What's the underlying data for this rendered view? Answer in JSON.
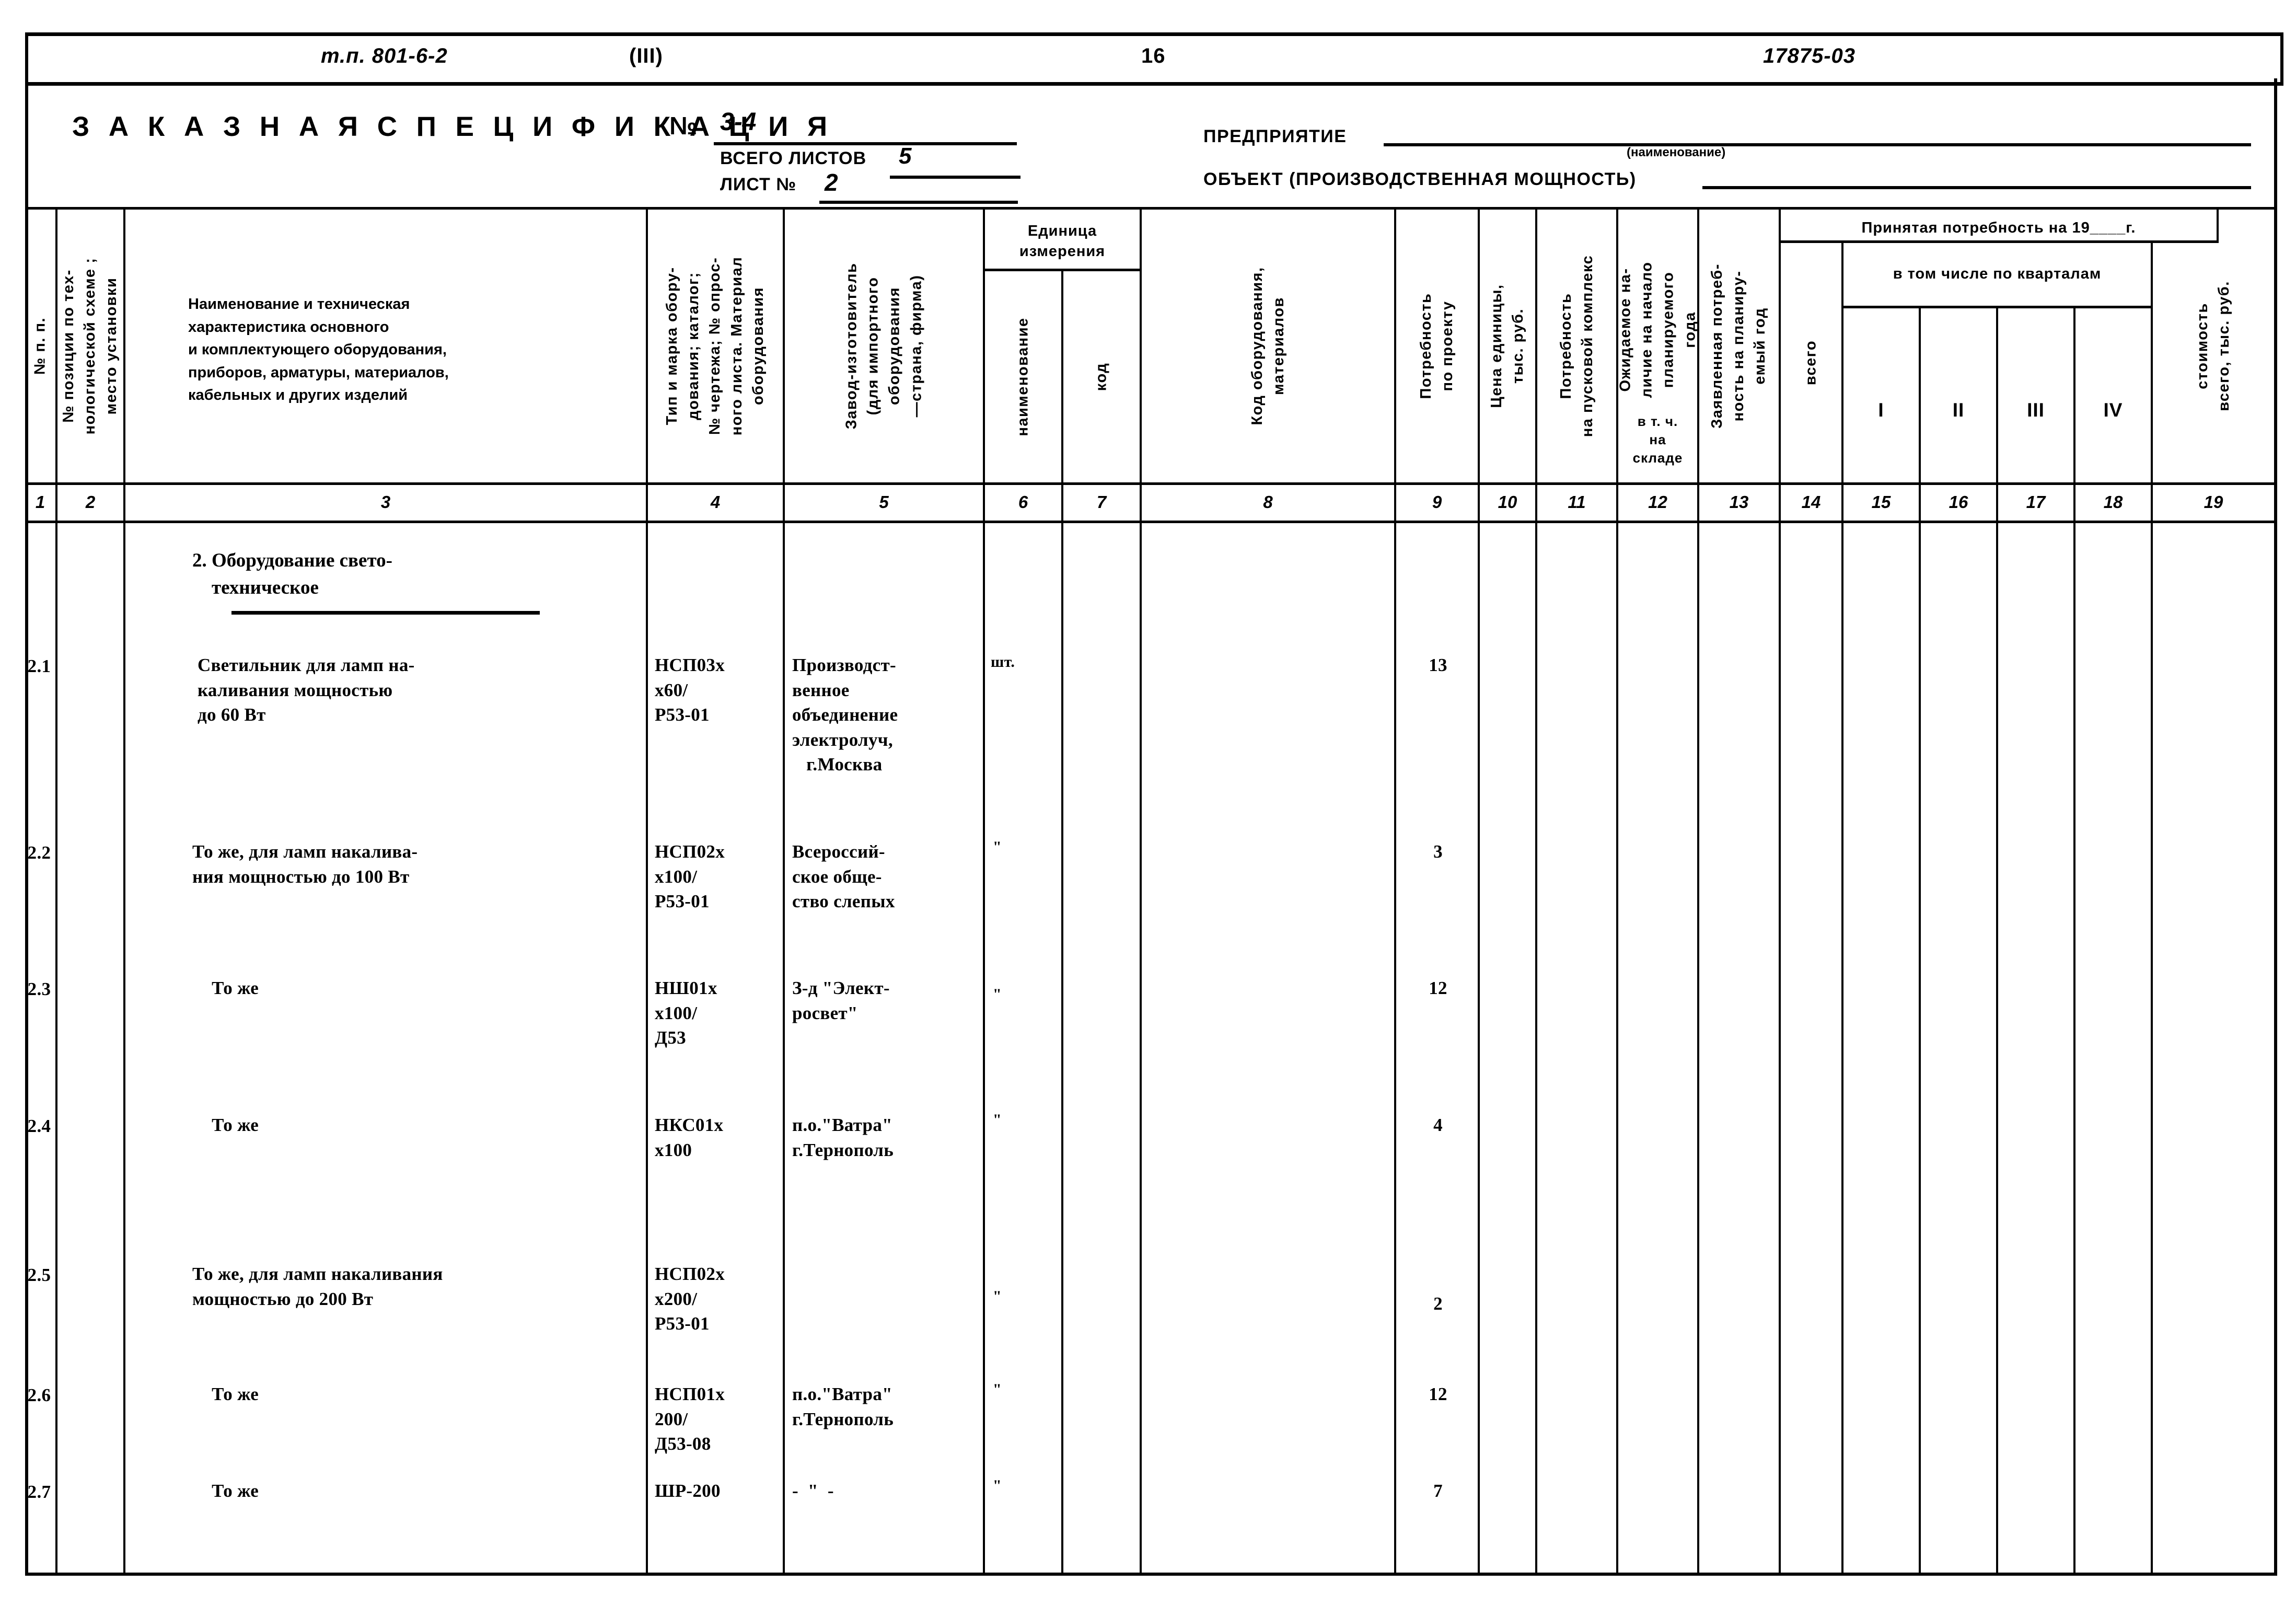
{
  "topbar": {
    "drawing_code": "т.п. 801-6-2",
    "section_roman": "(III)",
    "page_number": "16",
    "doc_number": "17875-03"
  },
  "title_block": {
    "title": "З А К А З Н А Я   С П Е Ц И Ф И К А Ц И Я",
    "number_label": "№",
    "number_value": "3-4",
    "total_sheets_label": "ВСЕГО ЛИСТОВ",
    "total_sheets_value": "5",
    "sheet_label": "ЛИСТ №",
    "sheet_value": "2",
    "enterprise_label": "ПРЕДПРИЯТИЕ",
    "enterprise_sub": "(наименование)",
    "object_label": "ОБЪЕКТ (ПРОИЗВОДСТВЕННАЯ  МОЩНОСТЬ)"
  },
  "table": {
    "group_headers": {
      "unit_of_measure": "Единица\nизмерения",
      "accepted_demand": "Принятая потребность на 19____г.",
      "by_quarters": "в том числе по кварталам"
    },
    "columns": [
      {
        "num": "1",
        "title": "№ п. п."
      },
      {
        "num": "2",
        "title": "№ позиции по тех-\nнологической схеме ;\nместо установки"
      },
      {
        "num": "3",
        "title": "Наименование и техническая\nхарактеристика основного\nи комплектующего оборудования,\nприборов, арматуры, материалов,\nкабельных и других изделий"
      },
      {
        "num": "4",
        "title": "Тип и марка обору-\nдования; каталог;\n№ чертежа; № опрос-\nного листа. Материал\nоборудования"
      },
      {
        "num": "5",
        "title": "Завод-изготовитель\n(для импортного\nоборудования\n—страна, фирма)"
      },
      {
        "num": "6",
        "title": "наименование"
      },
      {
        "num": "7",
        "title": "код"
      },
      {
        "num": "8",
        "title": "Код оборудования,\nматериалов"
      },
      {
        "num": "9",
        "title": "Потребность\nпо проекту"
      },
      {
        "num": "10",
        "title": "Цена единицы,\nтыс. руб."
      },
      {
        "num": "11",
        "title": "Потребность\nна пусковой комплекс"
      },
      {
        "num": "12",
        "title": "Ожидаемое на-\nличие на начало\nпланируемого\nгода",
        "sub": "в т. ч.\nна\nскладе"
      },
      {
        "num": "13",
        "title": "Заявленная потреб-\nность на планиру-\nемый год"
      },
      {
        "num": "14",
        "title": "всего"
      },
      {
        "num": "15",
        "title": "I"
      },
      {
        "num": "16",
        "title": "II"
      },
      {
        "num": "17",
        "title": "III"
      },
      {
        "num": "18",
        "title": "IV"
      },
      {
        "num": "19",
        "title": "стоимость\nвсего, тыс. руб."
      }
    ],
    "section": {
      "title": "2. Оборудование свето-\n    техническое"
    },
    "rows": [
      {
        "pos": "2.1",
        "name": "Светильник для ламп на-\nкаливания мощностью\nдо 60 Вт",
        "type": "НСП03х\nх60/\nР53-01",
        "manufacturer": "Производст-\nвенное\nобъединение\nэлектролуч,\n   г.Москва",
        "unit": "шт.",
        "qty": "13"
      },
      {
        "pos": "2.2",
        "name": "То же, для ламп накалива-\nния мощностью до 100 Вт",
        "type": "НСП02х\nх100/\nР53-01",
        "manufacturer": "Всероссий-\nское обще-\nство слепых",
        "unit": "\"",
        "qty": "3"
      },
      {
        "pos": "2.3",
        "name": "   То же",
        "type": "НШ01х\nх100/\nД53",
        "manufacturer": "З-д \"Элект-\nросвет\"",
        "unit": "\"",
        "qty": "12"
      },
      {
        "pos": "2.4",
        "name": "   То же",
        "type": "НКС01х\nх100",
        "manufacturer": "п.о.\"Ватра\"\nг.Тернополь",
        "unit": "\"",
        "qty": "4"
      },
      {
        "pos": "2.5",
        "name": "То же, для ламп накаливания\nмощностью до 200 Вт",
        "type": "НСП02х\nх200/\nР53-01",
        "manufacturer": "",
        "unit": "\"",
        "qty": "2"
      },
      {
        "pos": "2.6",
        "name": "   То же",
        "type": "НСП01х\n200/\nД53-08",
        "manufacturer": "п.о.\"Ватра\"\nг.Тернополь",
        "unit": "\"",
        "qty": "12"
      },
      {
        "pos": "2.7",
        "name": "   То же",
        "type": "ШР-200",
        "manufacturer": "-  \"  -",
        "unit": "\"",
        "qty": "7"
      }
    ]
  }
}
